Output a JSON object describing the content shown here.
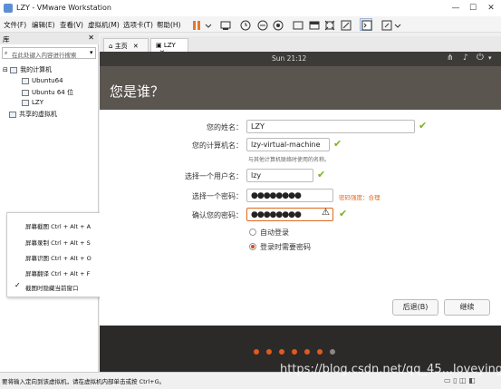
{
  "window": {
    "title": "LZY - VMware Workstation"
  },
  "menu": [
    "文件(F)",
    "编辑(E)",
    "查看(V)",
    "虚拟机(M)",
    "选项卡(T)",
    "帮助(H)"
  ],
  "library": {
    "header": "库",
    "search_placeholder": "在此处键入内容进行搜索",
    "root": "我的计算机",
    "vms": [
      "Ubuntu64",
      "Ubuntu 64 位",
      "LZY"
    ],
    "shared": "共享的虚拟机"
  },
  "context_menu": [
    "屏幕截图 Ctrl + Alt + A",
    "屏幕录制 Ctrl + Alt + S",
    "屏幕识图 Ctrl + Alt + O",
    "屏幕翻译 Ctrl + Alt + F",
    "截图时隐藏当前窗口"
  ],
  "tabs": [
    "主页",
    "LZY"
  ],
  "ubuntu": {
    "clock": "Sun 21:12",
    "heading": "您是谁？",
    "name_label": "您的姓名：",
    "name_value": "LZY",
    "computer_label": "您的计算机名：",
    "computer_value": "lzy-virtual-machine",
    "computer_hint": "与其他计算机联络时使用的名称。",
    "user_label": "选择一个用户名：",
    "user_value": "lzy",
    "pass_label": "选择一个密码：",
    "pass_value": "●●●●●●●●",
    "strength": "密码强度：合理",
    "confirm_label": "确认您的密码：",
    "confirm_value": "●●●●●●●●",
    "auto_login": "自动登录",
    "require_pass": "登录时需要密码",
    "back": "后退(B)",
    "next": "继续"
  },
  "status": "要将输入定向到该虚拟机，请在虚拟机内部单击或按 Ctrl+G。",
  "watermark": "https://blog.csdn.net/qq_45...loveyings",
  "colors": {
    "accent": "#dd4814",
    "check": "#7ab317",
    "ubuntu_dark": "#3c3b37"
  }
}
